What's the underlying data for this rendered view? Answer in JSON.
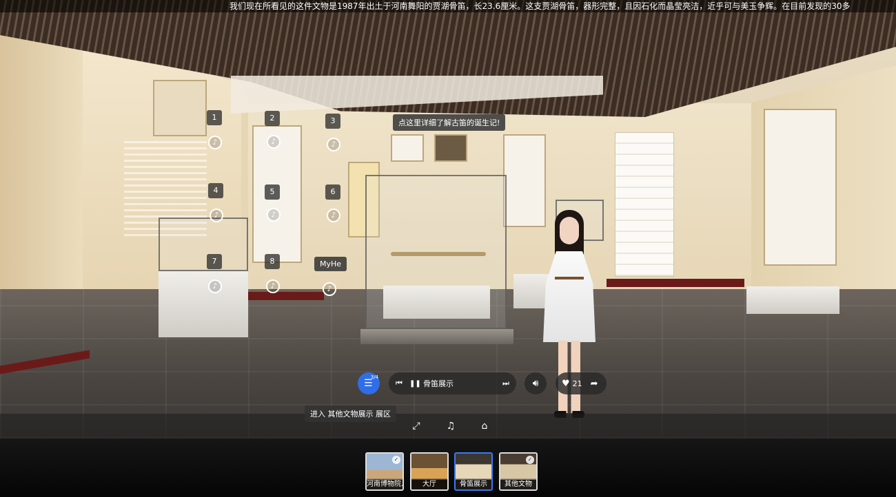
{
  "marquee": {
    "text": "我们现在所看见的这件文物是1987年出土于河南舞阳的贾湖骨笛，长23.6厘米。这支贾湖骨笛，器形完整，且因石化而晶莹亮洁，近乎可与美玉争辉。在目前发现的30多"
  },
  "scene": {
    "tooltip_top": "点这里详细了解古笛的诞生记!",
    "hotspots": [
      "1",
      "2",
      "3",
      "4",
      "5",
      "6",
      "7",
      "8"
    ],
    "myhe_label": "MyHe",
    "enter_tip": "进入 其他文物展示 展区"
  },
  "player": {
    "list_count": "3/4",
    "track_title": "骨笛展示",
    "likes": "21"
  },
  "scenes": [
    {
      "label": "河南博物院...",
      "checked": true
    },
    {
      "label": "大厅",
      "checked": false
    },
    {
      "label": "骨笛展示",
      "checked": false
    },
    {
      "label": "其他文物",
      "checked": true
    }
  ],
  "colors": {
    "accent": "#2f6ee8",
    "active_border": "#3b79f0"
  },
  "icons": {
    "list": "list-icon",
    "prev": "skip-previous-icon",
    "pause": "pause-icon",
    "next": "skip-next-icon",
    "volume": "volume-icon",
    "like": "heart-icon",
    "share": "share-icon",
    "fullscreen": "fullscreen-icon",
    "music": "music-off-icon",
    "vr": "vr-glasses-icon",
    "audio_hotspot": "music-note-icon"
  }
}
